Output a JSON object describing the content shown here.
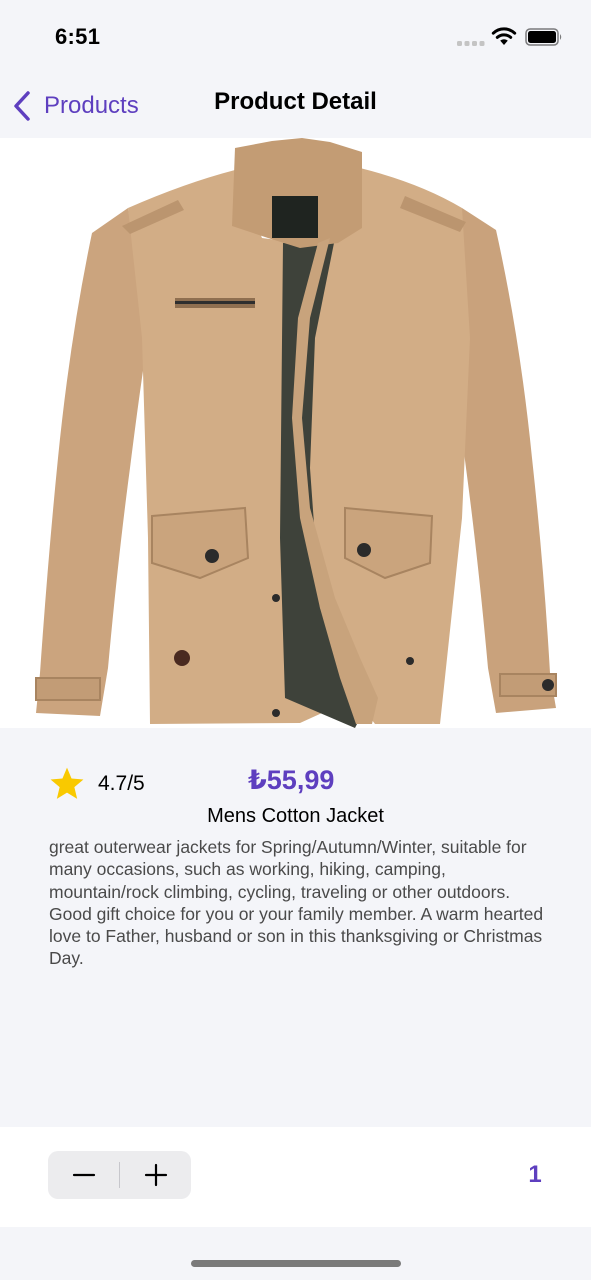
{
  "status": {
    "time": "6:51"
  },
  "nav": {
    "back_label": "Products",
    "title": "Product Detail"
  },
  "product": {
    "rating": "4.7/5",
    "price": "₺55,99",
    "name": "Mens Cotton Jacket",
    "description": "great outerwear jackets for Spring/Autumn/Winter, suitable for many occasions, such as working, hiking, camping, mountain/rock climbing, cycling, traveling or other outdoors. Good gift choice for you or your family member. A warm hearted love to Father, husband or son in this thanksgiving or Christmas Day.",
    "image_icon": "jacket-photo"
  },
  "cart": {
    "decrement_icon": "minus-icon",
    "increment_icon": "plus-icon",
    "quantity": "1"
  },
  "colors": {
    "accent": "#5e3fbf",
    "star": "#f9c900",
    "background": "#f4f5f9"
  }
}
